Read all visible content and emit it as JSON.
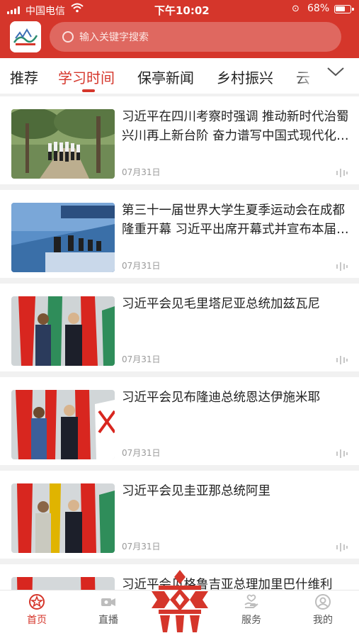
{
  "status_bar": {
    "carrier": "中国电信",
    "time": "下午10:02",
    "battery": "68%",
    "battery_level": 0.68
  },
  "header": {
    "search_placeholder": "输入关键字搜索",
    "colors": {
      "brand": "#d5362b"
    }
  },
  "tabs": [
    {
      "label": "推荐",
      "active": false
    },
    {
      "label": "学习时间",
      "active": true
    },
    {
      "label": "保亭新闻",
      "active": false
    },
    {
      "label": "乡村振兴",
      "active": false
    },
    {
      "label": "云",
      "active": false
    }
  ],
  "feed": [
    {
      "title": "习近平在四川考察时强调 推动新时代治蜀兴川再上新台阶 奋力谱写中国式现代化四川新篇章",
      "date": "07月31日"
    },
    {
      "title": "第三十一届世界大学生夏季运动会在成都隆重开幕 习近平出席开幕式并宣布本届大运会开幕",
      "date": "07月31日"
    },
    {
      "title": "习近平会见毛里塔尼亚总统加兹瓦尼",
      "date": "07月31日"
    },
    {
      "title": "习近平会见布隆迪总统恩达伊施米耶",
      "date": "07月31日"
    },
    {
      "title": "习近平会见圭亚那总统阿里",
      "date": "07月31日"
    },
    {
      "title": "习近平会见格鲁吉亚总理加里巴什维利",
      "date": ""
    }
  ],
  "bottom_nav": [
    {
      "label": "首页",
      "icon": "home-star-icon",
      "active": true
    },
    {
      "label": "直播",
      "icon": "live-camera-icon",
      "active": false
    },
    {
      "label": "服务",
      "icon": "service-hand-icon",
      "active": false
    },
    {
      "label": "我的",
      "icon": "profile-icon",
      "active": false
    }
  ]
}
